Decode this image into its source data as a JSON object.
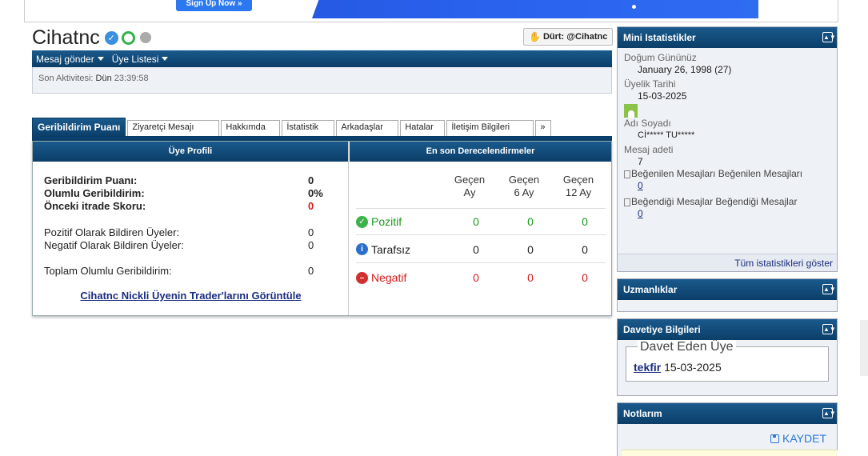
{
  "banner": {
    "signup_label": "Sign Up Now »"
  },
  "profile": {
    "username": "Cihatnc",
    "poke_label": "Dürt: @Cihatnc",
    "menu": [
      "Mesaj gönder",
      "Üye Listesi"
    ],
    "activity_label": "Son Aktivitesi:",
    "activity_day": "Dün",
    "activity_time": "23:39:58"
  },
  "tabs": [
    {
      "label": "Geribildirim Puanı",
      "active": true
    },
    {
      "label": "Ziyaretçi Mesajı"
    },
    {
      "label": "Hakkımda"
    },
    {
      "label": "İstatistik"
    },
    {
      "label": "Arkadaşlar"
    },
    {
      "label": "Hatalar"
    },
    {
      "label": "İletişim Bilgileri"
    },
    {
      "label": "»"
    }
  ],
  "feedback": {
    "left_title": "Üye Profili",
    "right_title": "En son Derecelendirmeler",
    "rows_bold": [
      {
        "label": "Geribildirim Puanı:",
        "value": "0"
      },
      {
        "label": "Olumlu Geribildirim:",
        "value": "0%"
      },
      {
        "label": "Önceki itrade Skoru:",
        "value": "0"
      }
    ],
    "rows_plain": [
      {
        "label": "Pozitif Olarak Bildiren Üyeler:",
        "value": "0"
      },
      {
        "label": "Negatif Olarak Bildiren Üyeler:",
        "value": "0"
      }
    ],
    "total": {
      "label": "Toplam Olumlu Geribildirim:",
      "value": "0"
    },
    "trader_link": "Cihatnc Nickli Üyenin Trader'larını Görüntüle",
    "periods": [
      "Geçen Ay",
      "Geçen 6 Ay",
      "Geçen 12 Ay"
    ],
    "period_lines": [
      [
        "Geçen",
        "Ay"
      ],
      [
        "Geçen",
        "6 Ay"
      ],
      [
        "Geçen",
        "12 Ay"
      ]
    ],
    "ratings": [
      {
        "label": "Pozitif",
        "values": [
          "0",
          "0",
          "0"
        ]
      },
      {
        "label": "Tarafsız",
        "values": [
          "0",
          "0",
          "0"
        ]
      },
      {
        "label": "Negatif",
        "values": [
          "0",
          "0",
          "0"
        ]
      }
    ]
  },
  "mini_stats": {
    "title": "Mini Istatistikler",
    "birthday_label": "Doğum Gününüz",
    "birthday_value": "January 26, 1998 (27)",
    "join_label": "Üyelik Tarihi",
    "join_value": "15-03-2025",
    "name_label": "Adı Soyadı",
    "name_value": "Cİ***** TU*****",
    "posts_label": "Mesaj adeti",
    "posts_value": "7",
    "liked_label": "Beğenilen Mesajları Beğenilen Mesajları",
    "liked_value": "0",
    "likes_given_label": "Beğendiği Mesajlar Beğendiği Mesajlar",
    "likes_given_value": "0",
    "show_all": "Tüm istatistikleri göster"
  },
  "expertise": {
    "title": "Uzmanlıklar"
  },
  "invite": {
    "title": "Davetiye Bilgileri",
    "legend": "Davet Eden Üye",
    "inviter": "tekfir",
    "date": "15-03-2025"
  },
  "notes": {
    "title": "Notlarım",
    "save_label": "KAYDET"
  }
}
